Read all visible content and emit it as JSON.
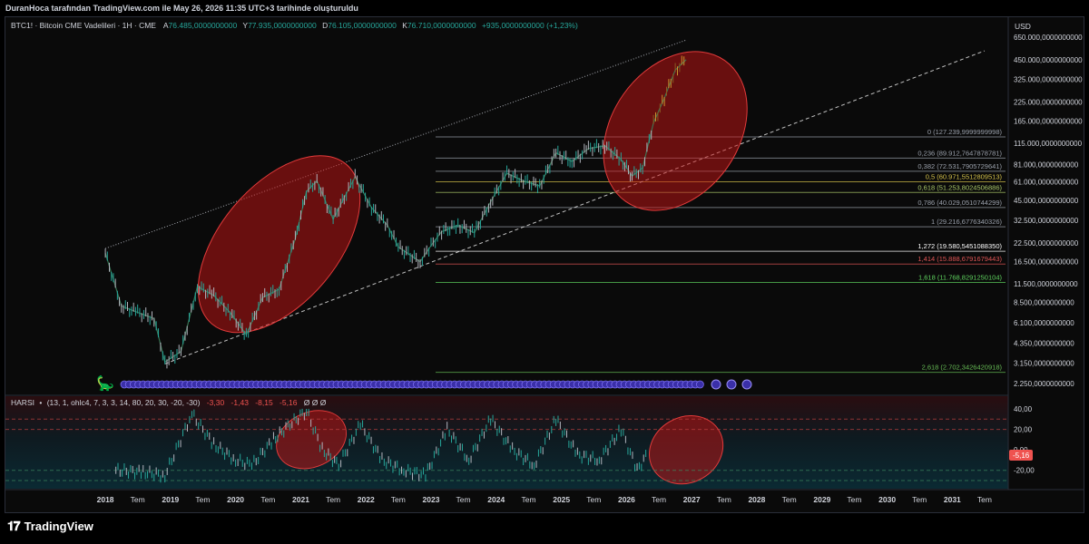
{
  "header": {
    "caption": "DuranHoca tarafından TradingView.com ile May 26, 2026 11:35 UTC+3 tarihinde oluşturuldu"
  },
  "legend": {
    "symbol": "BTC1! · Bitcoin CME Vadelileri · 1H · CME",
    "a_key": "A",
    "a_val": "76.485,0000000000",
    "y_key": "Y",
    "y_val": "77.935,0000000000",
    "d_key": "D",
    "d_val": "76.105,0000000000",
    "k_key": "K",
    "k_val": "76.710,0000000000",
    "change": "+935,0000000000 (+1,23%)"
  },
  "price_axis": {
    "currency": "USD",
    "ticks": [
      "650.000,0000000000",
      "450.000,0000000000",
      "325.000,0000000000",
      "225.000,0000000000",
      "165.000,0000000000",
      "115.000,0000000000",
      "81.000,0000000000",
      "61.000,0000000000",
      "45.000,0000000000",
      "32.500,0000000000",
      "22.500,0000000000",
      "16.500,0000000000",
      "11.500,0000000000",
      "8.500,0000000000",
      "6.100,0000000000",
      "4.350,0000000000",
      "3.150,0000000000",
      "2.250,0000000000"
    ]
  },
  "fib_levels": [
    {
      "label": "0 (127.239,9999999998)",
      "color": "#9aa0ab"
    },
    {
      "label": "0,236 (89.912,7647878781)",
      "color": "#9aa0ab"
    },
    {
      "label": "0,382 (72.531,7905729641)",
      "color": "#9aa0ab"
    },
    {
      "label": "0,5 (60.971,5512809513)",
      "color": "#d4c24a"
    },
    {
      "label": "0,618 (51.253,8024506886)",
      "color": "#a9c86a"
    },
    {
      "label": "0,786 (40.029,0510744299)",
      "color": "#9aa0ab"
    },
    {
      "label": "1 (29.216,6776340326)",
      "color": "#9aa0ab"
    },
    {
      "label": "1,272 (19.580,5451088350)",
      "color": "#ffffff"
    },
    {
      "label": "1,414 (15.888,6791679443)",
      "color": "#e05555"
    },
    {
      "label": "1,618 (11.768,8291250104)",
      "color": "#5fd35f"
    },
    {
      "label": "2,618 (2.702,3426420918)",
      "color": "#66bb55"
    }
  ],
  "indicator": {
    "title": "HARSI",
    "params": "(13, 1, ohlc4, 7, 3, 3, 14, 80, 20, 30, -20, -30)",
    "v1": "-3,30",
    "v2": "-1,43",
    "v3": "-8,15",
    "v4": "-5,16",
    "tail": "Ø Ø Ø",
    "axis": [
      "40,00",
      "20,00",
      "0,00",
      "-20,00"
    ],
    "current": "-5,16"
  },
  "time_axis": [
    "2018",
    "Tem",
    "2019",
    "Tem",
    "2020",
    "Tem",
    "2021",
    "Tem",
    "2022",
    "Tem",
    "2023",
    "Tem",
    "2024",
    "Tem",
    "2025",
    "Tem",
    "2026",
    "Tem",
    "2027",
    "Tem",
    "2028",
    "Tem",
    "2029",
    "Tem",
    "2030",
    "Tem",
    "2031",
    "Tem"
  ],
  "footer": {
    "brand": "TradingView"
  },
  "chart_data": {
    "type": "line",
    "title": "BTC1! · Bitcoin CME Vadelileri · 1H · CME",
    "xlabel": "",
    "ylabel": "USD",
    "scale": "log",
    "ylim": [
      2250,
      650000
    ],
    "x": [
      "2018-01",
      "2018-04",
      "2018-07",
      "2018-10",
      "2018-12",
      "2019-03",
      "2019-06",
      "2019-09",
      "2019-12",
      "2020-03",
      "2020-06",
      "2020-09",
      "2020-12",
      "2021-02",
      "2021-04",
      "2021-07",
      "2021-09",
      "2021-11",
      "2022-02",
      "2022-05",
      "2022-07",
      "2022-11",
      "2023-01",
      "2023-03",
      "2023-06",
      "2023-09",
      "2023-12",
      "2024-03",
      "2024-06",
      "2024-09",
      "2024-12",
      "2025-03",
      "2025-06",
      "2025-09",
      "2025-12",
      "2026-02",
      "2026-04",
      "2026-06",
      "2026-08",
      "2026-10",
      "2026-12"
    ],
    "series": [
      {
        "values": [
          19000,
          8000,
          7200,
          6500,
          3200,
          3800,
          11000,
          9500,
          7200,
          5000,
          9200,
          10500,
          24000,
          52000,
          62000,
          33000,
          47000,
          66000,
          40000,
          30000,
          21000,
          16500,
          21500,
          27000,
          30000,
          26500,
          44000,
          70000,
          62000,
          57000,
          98000,
          85000,
          105000,
          110000,
          88000,
          67000,
          76710,
          160000,
          240000,
          380000,
          450000
        ]
      }
    ],
    "fib_levels": [
      {
        "ratio": 0,
        "value": 127239.9999999998
      },
      {
        "ratio": 0.236,
        "value": 89912.7647878781
      },
      {
        "ratio": 0.382,
        "value": 72531.7905729641
      },
      {
        "ratio": 0.5,
        "value": 60971.5512809513
      },
      {
        "ratio": 0.618,
        "value": 51253.8024506886
      },
      {
        "ratio": 0.786,
        "value": 40029.0510744299
      },
      {
        "ratio": 1,
        "value": 29216.6776340326
      },
      {
        "ratio": 1.272,
        "value": 19580.545108835
      },
      {
        "ratio": 1.414,
        "value": 15888.6791679443
      },
      {
        "ratio": 1.618,
        "value": 11768.8291250104
      },
      {
        "ratio": 2.618,
        "value": 2702.3426420918
      }
    ],
    "oscillator": {
      "name": "HARSI",
      "ylim": [
        -30,
        40
      ],
      "levels": [
        30,
        20,
        -20,
        -30
      ],
      "x": [
        "2018-03",
        "2018-08",
        "2018-12",
        "2019-05",
        "2019-09",
        "2020-01",
        "2020-04",
        "2020-08",
        "2020-11",
        "2021-02",
        "2021-05",
        "2021-08",
        "2021-12",
        "2022-04",
        "2022-08",
        "2022-12",
        "2023-04",
        "2023-08",
        "2023-12",
        "2024-04",
        "2024-08",
        "2024-12",
        "2025-04",
        "2025-08",
        "2025-12",
        "2026-03",
        "2026-05"
      ],
      "values": [
        -20,
        -22,
        -25,
        35,
        5,
        -10,
        -15,
        10,
        25,
        38,
        0,
        -15,
        25,
        -10,
        -20,
        -25,
        20,
        -10,
        30,
        0,
        -15,
        30,
        -5,
        -10,
        20,
        -20,
        -3
      ]
    }
  }
}
